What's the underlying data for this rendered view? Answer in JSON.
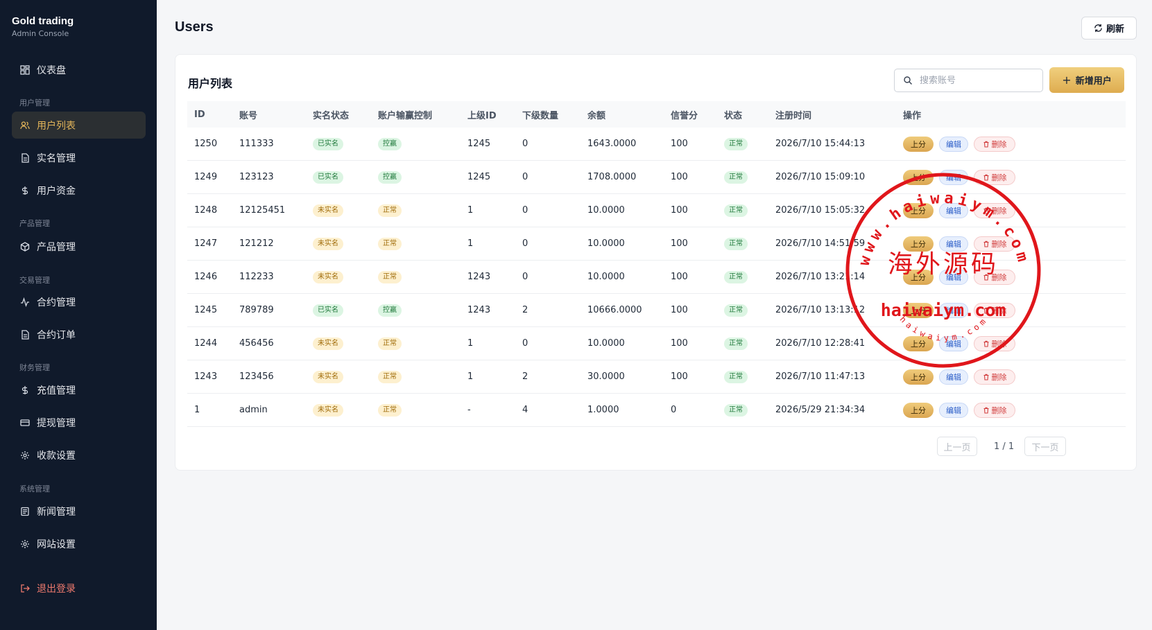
{
  "app": {
    "title": "Gold trading",
    "subtitle": "Admin Console"
  },
  "sidebar": {
    "dashboard": "仪表盘",
    "group_user": "用户管理",
    "user_list": "用户列表",
    "realname": "实名管理",
    "funds": "用户资金",
    "group_product": "产品管理",
    "product": "产品管理",
    "group_trade": "交易管理",
    "contract": "合约管理",
    "contract_orders": "合约订单",
    "group_finance": "财务管理",
    "recharge": "充值管理",
    "withdraw": "提现管理",
    "payment": "收款设置",
    "group_system": "系统管理",
    "news": "新闻管理",
    "site": "网站设置",
    "logout": "退出登录"
  },
  "header": {
    "title": "Users",
    "refresh": "刷新"
  },
  "card": {
    "title": "用户列表",
    "search_placeholder": "搜索账号",
    "add_button": "新增用户"
  },
  "table": {
    "columns": [
      "ID",
      "账号",
      "实名状态",
      "账户输赢控制",
      "上级ID",
      "下级数量",
      "余额",
      "信誉分",
      "状态",
      "注册时间",
      "操作"
    ],
    "actions": {
      "up": "上分",
      "edit": "编辑",
      "delete": "删除"
    },
    "rows": [
      {
        "id": "1250",
        "account": "111333",
        "kyc": "已实名",
        "kyc_ok": true,
        "control": "控赢",
        "control_win": true,
        "parent": "1245",
        "children": "0",
        "balance": "1643.0000",
        "credit": "100",
        "status": "正常",
        "time": "2026/7/10 15:44:13"
      },
      {
        "id": "1249",
        "account": "123123",
        "kyc": "已实名",
        "kyc_ok": true,
        "control": "控赢",
        "control_win": true,
        "parent": "1245",
        "children": "0",
        "balance": "1708.0000",
        "credit": "100",
        "status": "正常",
        "time": "2026/7/10 15:09:10"
      },
      {
        "id": "1248",
        "account": "12125451",
        "kyc": "未实名",
        "kyc_ok": false,
        "control": "正常",
        "control_win": false,
        "parent": "1",
        "children": "0",
        "balance": "10.0000",
        "credit": "100",
        "status": "正常",
        "time": "2026/7/10 15:05:32"
      },
      {
        "id": "1247",
        "account": "121212",
        "kyc": "未实名",
        "kyc_ok": false,
        "control": "正常",
        "control_win": false,
        "parent": "1",
        "children": "0",
        "balance": "10.0000",
        "credit": "100",
        "status": "正常",
        "time": "2026/7/10 14:51:59"
      },
      {
        "id": "1246",
        "account": "112233",
        "kyc": "未实名",
        "kyc_ok": false,
        "control": "正常",
        "control_win": false,
        "parent": "1243",
        "children": "0",
        "balance": "10.0000",
        "credit": "100",
        "status": "正常",
        "time": "2026/7/10 13:21:14"
      },
      {
        "id": "1245",
        "account": "789789",
        "kyc": "已实名",
        "kyc_ok": true,
        "control": "控赢",
        "control_win": true,
        "parent": "1243",
        "children": "2",
        "balance": "10666.0000",
        "credit": "100",
        "status": "正常",
        "time": "2026/7/10 13:13:12"
      },
      {
        "id": "1244",
        "account": "456456",
        "kyc": "未实名",
        "kyc_ok": false,
        "control": "正常",
        "control_win": false,
        "parent": "1",
        "children": "0",
        "balance": "10.0000",
        "credit": "100",
        "status": "正常",
        "time": "2026/7/10 12:28:41"
      },
      {
        "id": "1243",
        "account": "123456",
        "kyc": "未实名",
        "kyc_ok": false,
        "control": "正常",
        "control_win": false,
        "parent": "1",
        "children": "2",
        "balance": "30.0000",
        "credit": "100",
        "status": "正常",
        "time": "2026/7/10 11:47:13"
      },
      {
        "id": "1",
        "account": "admin",
        "kyc": "未实名",
        "kyc_ok": false,
        "control": "正常",
        "control_win": false,
        "parent": "-",
        "children": "4",
        "balance": "1.0000",
        "credit": "0",
        "status": "正常",
        "time": "2026/5/29 21:34:34"
      }
    ]
  },
  "pagination": {
    "prev": "上一页",
    "info": "1 / 1",
    "next": "下一页"
  },
  "watermark": {
    "top": "www.haiwaiym.com",
    "center": "海外源码",
    "domain": "haiwaiym.com",
    "bottom": "haiwaiym.com"
  },
  "colors": {
    "accent": "#deac4f",
    "sidebar_bg": "#101a2b",
    "stamp": "#e0161b"
  }
}
